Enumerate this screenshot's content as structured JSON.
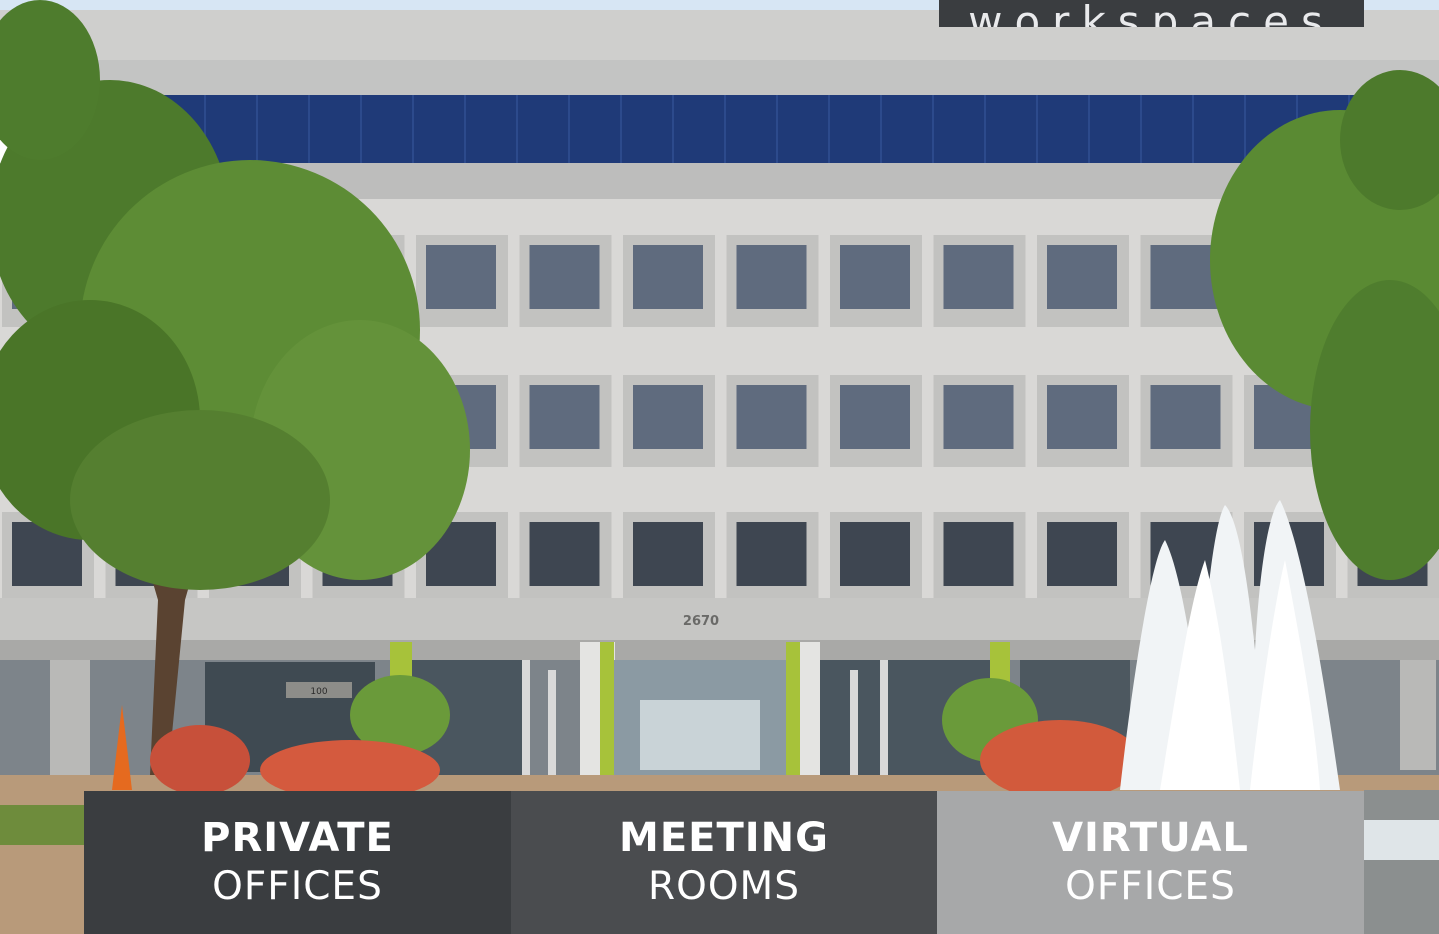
{
  "header_tab": {
    "label": "workspaces"
  },
  "building": {
    "number": "2670",
    "suite": "100"
  },
  "tiles": [
    {
      "title": "PRIVATE",
      "subtitle": "OFFICES"
    },
    {
      "title": "MEETING",
      "subtitle": "ROOMS"
    },
    {
      "title": "VIRTUAL",
      "subtitle": "OFFICES"
    }
  ],
  "colors": {
    "tile_private": "#3a3d40",
    "tile_meeting": "#4a4c4f",
    "tile_virtual": "#a7a8a9",
    "building_facade": "#d9d8d6",
    "window_band": "#1f3a78",
    "accent_green": "#a7c23a"
  }
}
